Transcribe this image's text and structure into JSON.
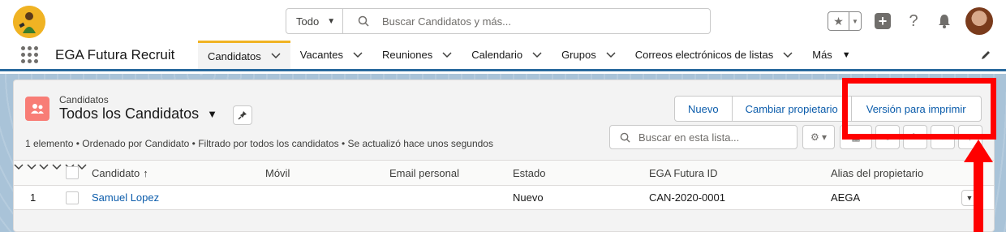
{
  "header": {
    "search_scope": "Todo",
    "search_placeholder": "Buscar Candidatos y más...",
    "icons": [
      "favorites-star-icon",
      "plus-icon",
      "help-icon",
      "bell-icon"
    ]
  },
  "nav": {
    "app_name": "EGA Futura Recruit",
    "tabs": [
      {
        "label": "Candidatos",
        "active": true
      },
      {
        "label": "Vacantes"
      },
      {
        "label": "Reuniones"
      },
      {
        "label": "Calendario"
      },
      {
        "label": "Grupos"
      },
      {
        "label": "Correos electrónicos de listas"
      },
      {
        "label": "Más"
      }
    ]
  },
  "list_view": {
    "object_label": "Candidatos",
    "title": "Todos los Candidatos",
    "buttons": {
      "new": "Nuevo",
      "change_owner": "Cambiar propietario",
      "print": "Versión para imprimir"
    },
    "info": "1 elemento • Ordenado por Candidato • Filtrado por todos los candidatos • Se actualizó hace unos segundos",
    "search_placeholder": "Buscar en esta lista...",
    "columns": [
      "Candidato",
      "Móvil",
      "Email personal",
      "Estado",
      "EGA Futura ID",
      "Alias del propietario"
    ],
    "sort_indicator": "↑",
    "rows": [
      {
        "num": "1",
        "candidato": "Samuel Lopez",
        "movil": "",
        "email": "",
        "estado": "Nuevo",
        "ega_id": "CAN-2020-0001",
        "alias": "AEGA"
      }
    ]
  },
  "colors": {
    "accent": "#0b5cab",
    "tab_active_border": "#f0b323",
    "annotation": "#ff0000"
  }
}
